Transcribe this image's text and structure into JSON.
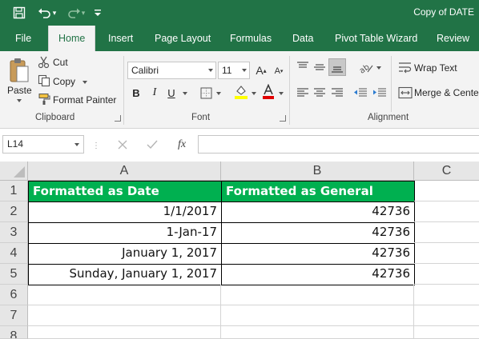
{
  "title_bar": {
    "doc_title": "Copy of DATE"
  },
  "tabs": [
    {
      "label": "File"
    },
    {
      "label": "Home"
    },
    {
      "label": "Insert"
    },
    {
      "label": "Page Layout"
    },
    {
      "label": "Formulas"
    },
    {
      "label": "Data"
    },
    {
      "label": "Pivot Table Wizard"
    },
    {
      "label": "Review"
    }
  ],
  "ribbon": {
    "clipboard": {
      "paste": "Paste",
      "cut": "Cut",
      "copy": "Copy",
      "format_painter": "Format Painter",
      "group_label": "Clipboard"
    },
    "font": {
      "font_name": "Calibri",
      "font_size": "11",
      "bold": "B",
      "italic": "I",
      "underline": "U",
      "group_label": "Font"
    },
    "alignment": {
      "wrap_text": "Wrap Text",
      "merge_center": "Merge & Center",
      "group_label": "Alignment"
    }
  },
  "formula_bar": {
    "name_box": "L14",
    "fx": "fx",
    "formula": ""
  },
  "columns": [
    "A",
    "B",
    "C"
  ],
  "rows": [
    "1",
    "2",
    "3",
    "4",
    "5",
    "6",
    "7",
    "8"
  ],
  "cells": {
    "A1": "Formatted as Date",
    "B1": "Formatted as General",
    "A2": "1/1/2017",
    "B2": "42736",
    "A3": "1-Jan-17",
    "B3": "42736",
    "A4": "January 1, 2017",
    "B4": "42736",
    "A5": "Sunday, January 1, 2017",
    "B5": "42736"
  },
  "colors": {
    "excel_green": "#217346",
    "header_fill": "#00b050"
  }
}
